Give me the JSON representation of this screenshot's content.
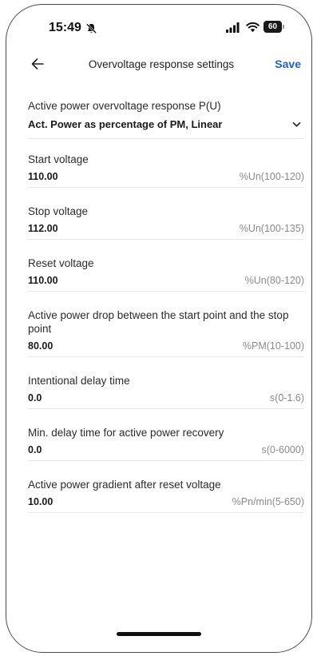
{
  "status_bar": {
    "time": "15:49",
    "battery": "60"
  },
  "header": {
    "title": "Overvoltage response settings",
    "save_label": "Save"
  },
  "response_mode": {
    "label": "Active power overvoltage response P(U)",
    "value": "Act. Power as percentage of PM, Linear"
  },
  "fields": [
    {
      "label": "Start voltage",
      "value": "110.00",
      "range": "%Un(100-120)"
    },
    {
      "label": "Stop voltage",
      "value": "112.00",
      "range": "%Un(100-135)"
    },
    {
      "label": "Reset voltage",
      "value": "110.00",
      "range": "%Un(80-120)"
    },
    {
      "label": "Active power drop between the start point and the stop point",
      "value": "80.00",
      "range": "%PM(10-100)"
    },
    {
      "label": "Intentional delay time",
      "value": "0.0",
      "range": "s(0-1.6)"
    },
    {
      "label": "Min. delay time for active power recovery",
      "value": "0.0",
      "range": "s(0-6000)"
    },
    {
      "label": "Active power gradient after reset voltage",
      "value": "10.00",
      "range": "%Pn/min(5-650)"
    }
  ]
}
